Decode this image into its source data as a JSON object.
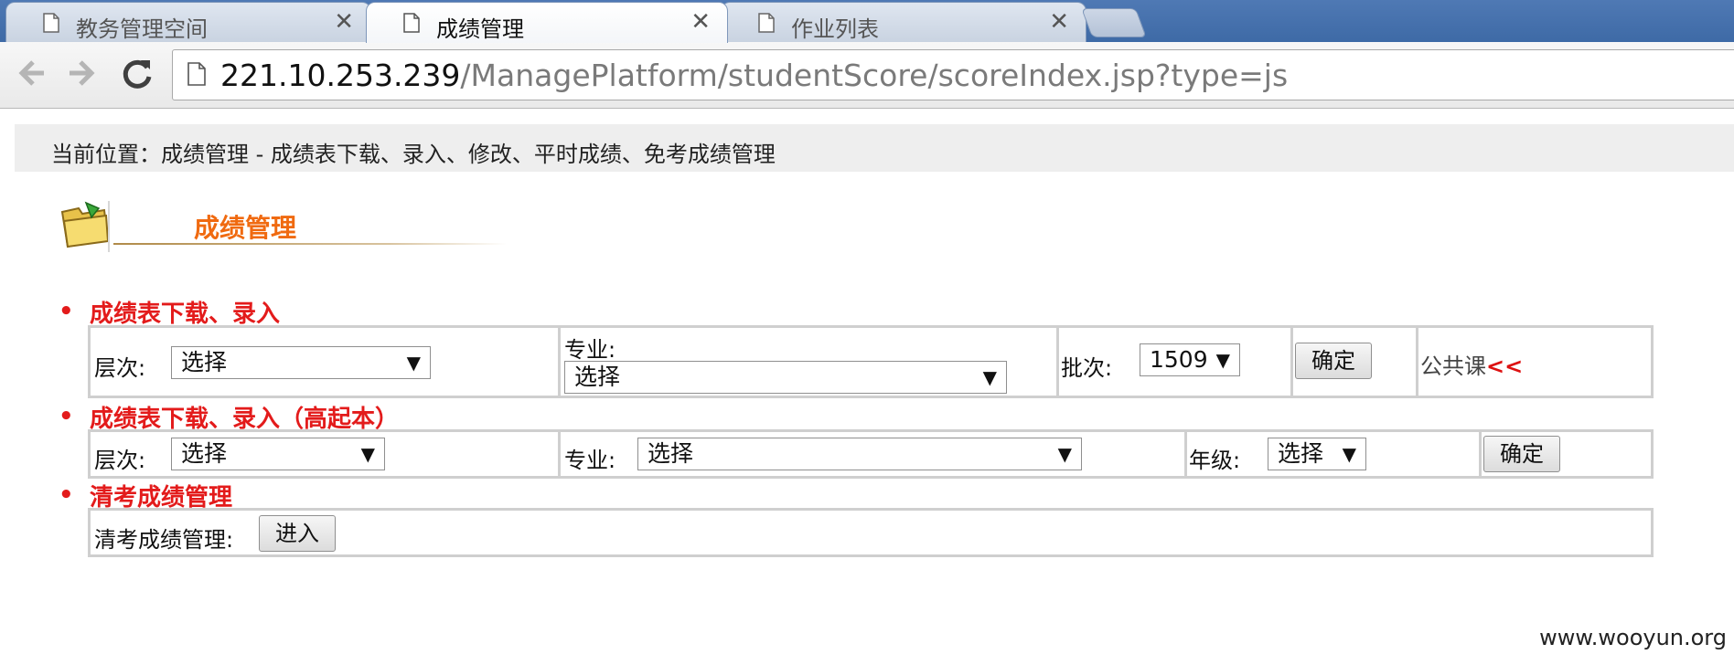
{
  "browser": {
    "tabs": [
      {
        "label": "教务管理空间",
        "active": false
      },
      {
        "label": "成绩管理",
        "active": true
      },
      {
        "label": "作业列表",
        "active": false
      }
    ],
    "close_glyph": "✕",
    "url_host": "221.10.253.239",
    "url_path": "/ManagePlatform/studentScore/scoreIndex.jsp?type=js"
  },
  "page": {
    "breadcrumb": "当前位置：成绩管理 - 成绩表下载、录入、修改、平时成绩、免考成绩管理",
    "title": "成绩管理",
    "bullet": "•"
  },
  "section1": {
    "title": "成绩表下载、录入",
    "level_label": "层次:",
    "level_value": "选择",
    "major_label": "专业:",
    "major_value": "选择",
    "batch_label": "批次:",
    "batch_value": "1509",
    "confirm": "确定",
    "public_course": "公共课",
    "public_course_chev": "<<"
  },
  "section2": {
    "title": "成绩表下载、录入（高起本）",
    "level_label": "层次:",
    "level_value": "选择",
    "major_label": "专业:",
    "major_value": "选择",
    "grade_label": "年级:",
    "grade_value": "选择",
    "confirm": "确定"
  },
  "section3": {
    "title": "清考成绩管理",
    "label": "清考成绩管理:",
    "enter": "进入"
  },
  "watermark": "www.wooyun.org",
  "colors": {
    "accent_title": "#f06a10",
    "section_red": "#e31b1b"
  },
  "icons": [
    "document-icon",
    "close-icon",
    "back-arrow-icon",
    "forward-arrow-icon",
    "reload-icon",
    "folder-icon",
    "dropdown-arrow-icon"
  ]
}
